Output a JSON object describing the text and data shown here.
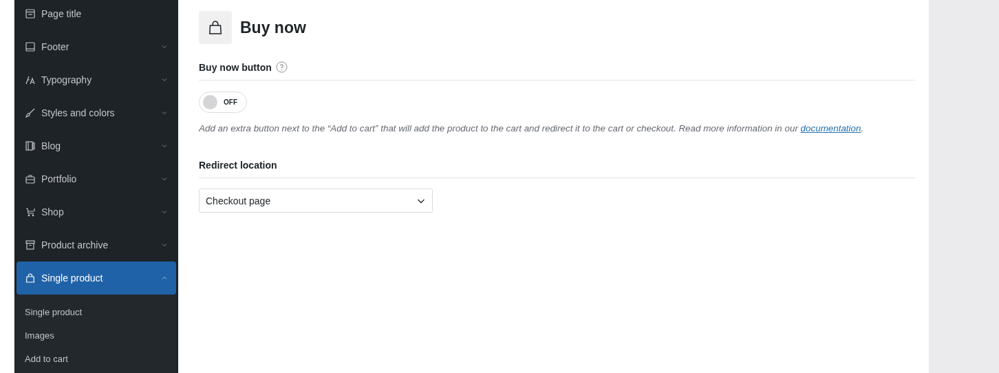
{
  "sidebar": {
    "items": [
      {
        "label": "Page title",
        "selected": false
      },
      {
        "label": "Footer",
        "expandable": true,
        "selected": false,
        "expanded": false
      },
      {
        "label": "Typography",
        "expandable": true,
        "selected": false,
        "expanded": false
      },
      {
        "label": "Styles and colors",
        "expandable": true,
        "selected": false,
        "expanded": false
      },
      {
        "label": "Blog",
        "expandable": true,
        "selected": false,
        "expanded": false
      },
      {
        "label": "Portfolio",
        "expandable": true,
        "selected": false,
        "expanded": false
      },
      {
        "label": "Shop",
        "expandable": true,
        "selected": false,
        "expanded": false
      },
      {
        "label": "Product archive",
        "expandable": true,
        "selected": false,
        "expanded": false
      },
      {
        "label": "Single product",
        "expandable": true,
        "selected": true,
        "expanded": true,
        "children": [
          {
            "label": "Single product"
          },
          {
            "label": "Images"
          },
          {
            "label": "Add to cart"
          }
        ]
      }
    ]
  },
  "panel": {
    "title": "Buy now",
    "sections": [
      {
        "kind": "toggle",
        "label": "Buy now button",
        "help": true,
        "on": false,
        "state_label": "OFF",
        "description": {
          "text": "Add an extra button next to the “Add to cart” that will add the product to the cart and redirect it to the cart or checkout. Read more information in our ",
          "link": "documentation",
          "end": "."
        }
      },
      {
        "kind": "select",
        "label": "Redirect location",
        "value": "Checkout page"
      }
    ]
  }
}
